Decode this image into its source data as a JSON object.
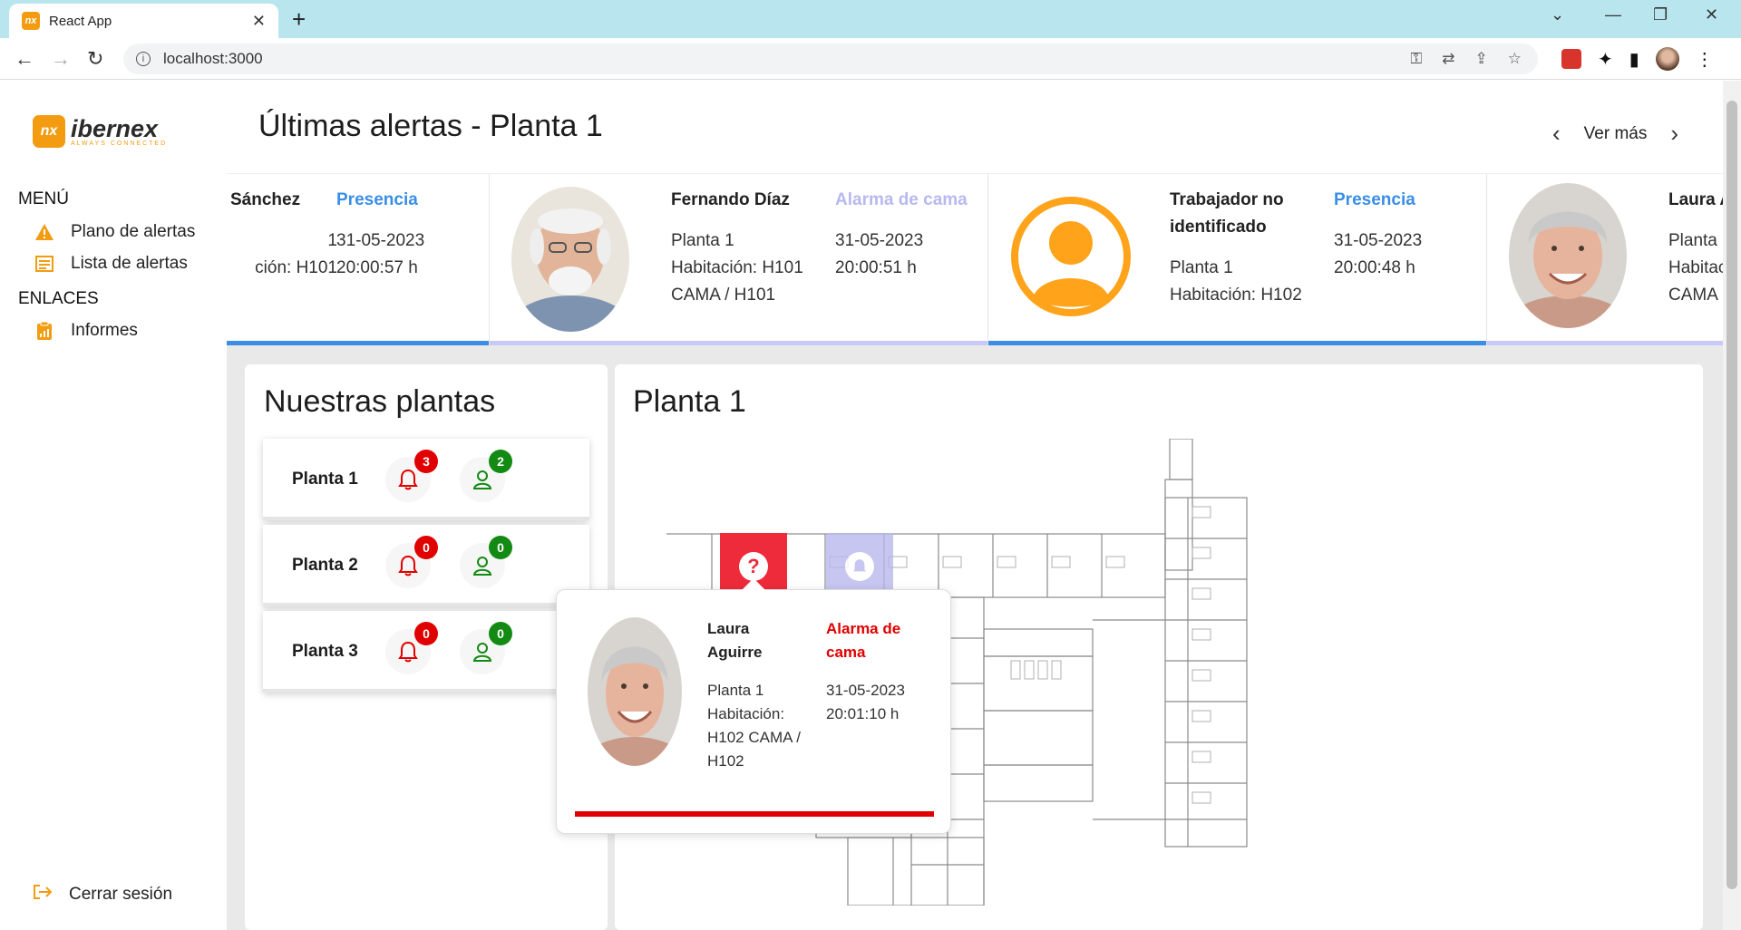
{
  "browser": {
    "tab_title": "React App",
    "url": "localhost:3000"
  },
  "sidebar": {
    "logo_text": "ibernex",
    "logo_tagline": "ALWAYS CONNECTED",
    "menu_heading": "MENÚ",
    "menu_items": [
      {
        "label": "Plano de alertas",
        "icon": "warning-icon"
      },
      {
        "label": "Lista de alertas",
        "icon": "list-icon"
      }
    ],
    "links_heading": "ENLACES",
    "link_items": [
      {
        "label": "Informes",
        "icon": "report-icon"
      }
    ],
    "logout_label": "Cerrar sesión"
  },
  "header": {
    "title": "Últimas alertas - Planta 1",
    "more_label": "Ver más"
  },
  "alerts": [
    {
      "name": "Sánchez",
      "type": "Presencia",
      "type_color": "#3a8ee6",
      "info": [
        "1",
        "ción: H101"
      ],
      "date": "31-05-2023",
      "time": "20:00:57 h",
      "bar_color": "#3a8ee6"
    },
    {
      "name": "Fernando Díaz",
      "type": "Alarma de cama",
      "type_color": "#b8b8f0",
      "info": [
        "Planta 1",
        "Habitación: H101",
        "CAMA / H101"
      ],
      "date": "31-05-2023",
      "time": "20:00:51 h",
      "bar_color": "#c9c9f5"
    },
    {
      "name": "Trabajador no identificado",
      "type": "Presencia",
      "type_color": "#3a8ee6",
      "info": [
        "Planta 1",
        "Habitación: H102"
      ],
      "date": "31-05-2023",
      "time": "20:00:48 h",
      "bar_color": "#3a8ee6"
    },
    {
      "name": "Laura A",
      "info": [
        "Planta",
        "Habitac",
        "CAMA"
      ],
      "bar_color": "#c9c9f5"
    }
  ],
  "floors_panel": {
    "title": "Nuestras plantas",
    "floors": [
      {
        "name": "Planta 1",
        "alerts": "3",
        "people": "2"
      },
      {
        "name": "Planta 2",
        "alerts": "0",
        "people": "0"
      },
      {
        "name": "Planta 3",
        "alerts": "0",
        "people": "0"
      }
    ]
  },
  "plan_panel": {
    "title": "Planta 1"
  },
  "popup": {
    "name": "Laura Aguirre",
    "type": "Alarma de cama",
    "info": "Planta 1 Habitación: H102 CAMA / H102",
    "date": "31-05-2023",
    "time": "20:01:10 h"
  },
  "colors": {
    "accent": "#f39c12",
    "alert_red": "#e00000",
    "presence_blue": "#3a8ee6",
    "people_green": "#138a13"
  }
}
